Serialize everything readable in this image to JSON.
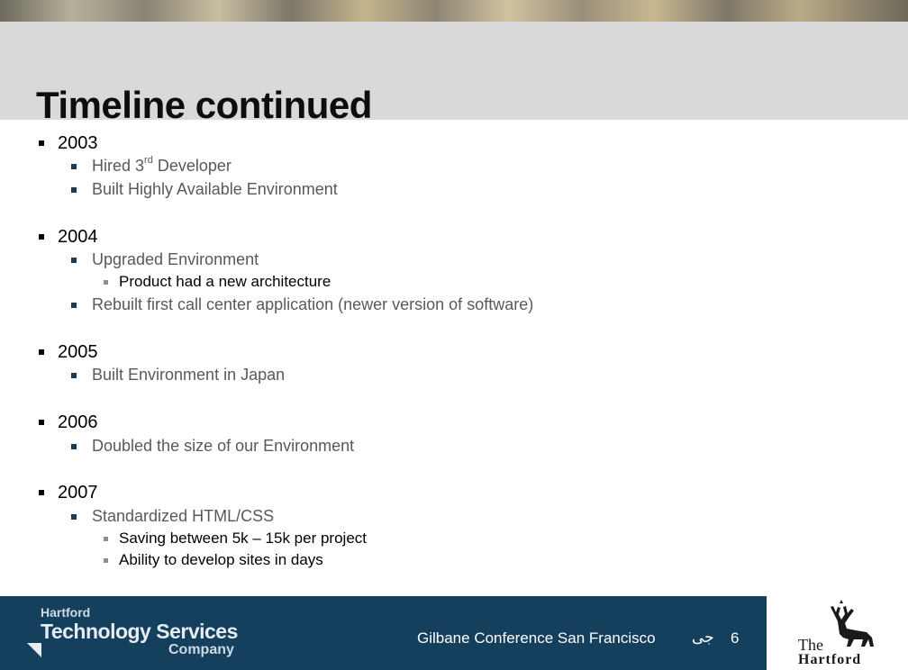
{
  "slide": {
    "title": "Timeline continued"
  },
  "timeline": {
    "y2003": {
      "year": "2003",
      "item1_pre": "Hired 3",
      "item1_sup": "rd",
      "item1_post": " Developer",
      "item2": "Built Highly Available Environment"
    },
    "y2004": {
      "year": "2004",
      "item1": "Upgraded Environment",
      "item1_sub": "Product had a new architecture",
      "item2": "Rebuilt first call center application (newer version of software)"
    },
    "y2005": {
      "year": "2005",
      "item1": "Built Environment in Japan"
    },
    "y2006": {
      "year": "2006",
      "item1": "Doubled the size of our Environment"
    },
    "y2007": {
      "year": "2007",
      "item1": "Standardized HTML/CSS",
      "sub1": "Saving between 5k – 15k per project",
      "sub2": "Ability to develop sites in days"
    }
  },
  "footer": {
    "logo_line1": "Hartford",
    "logo_line2": "Technology Services",
    "logo_line3": "Company",
    "conference": "Gilbane Conference San Francisco",
    "symbol": "جى",
    "page": "6",
    "brand": "The Hartford",
    "brand_line1": "The",
    "brand_line2": "Hartford"
  },
  "colors": {
    "footer_bg": "#14405e",
    "title_band": "#d9d9d9"
  }
}
